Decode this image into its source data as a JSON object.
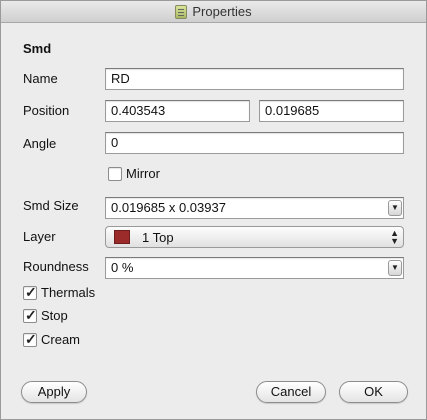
{
  "window": {
    "title": "Properties",
    "title_icon": "document-icon"
  },
  "section": {
    "heading": "Smd"
  },
  "name": {
    "label": "Name",
    "value": "RD"
  },
  "position": {
    "label": "Position",
    "x": "0.403543",
    "y": "0.019685"
  },
  "angle": {
    "label": "Angle",
    "value": "0"
  },
  "mirror": {
    "label": "Mirror",
    "checked": false
  },
  "smd_size": {
    "label": "Smd Size",
    "value": "0.019685 x 0.03937"
  },
  "layer": {
    "label": "Layer",
    "value": "1 Top",
    "swatch_color": "#9b2a2a"
  },
  "roundness": {
    "label": "Roundness",
    "value": "0 %"
  },
  "thermals": {
    "label": "Thermals",
    "checked": true
  },
  "stop": {
    "label": "Stop",
    "checked": true
  },
  "cream": {
    "label": "Cream",
    "checked": true
  },
  "buttons": {
    "apply": "Apply",
    "cancel": "Cancel",
    "ok": "OK"
  }
}
